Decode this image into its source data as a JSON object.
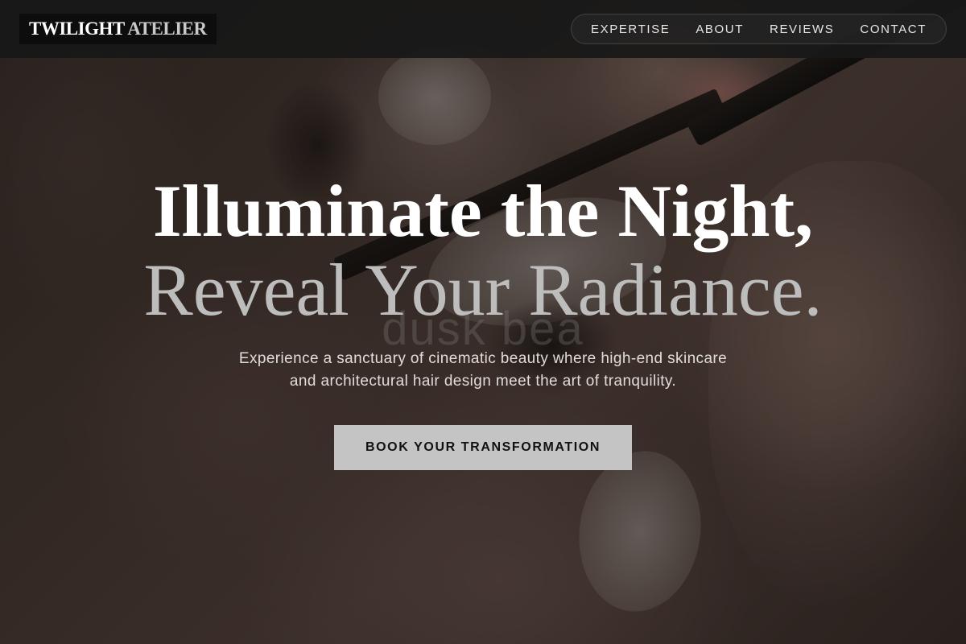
{
  "brand": {
    "word1": "TWILIGHT",
    "word2": "ATELIER"
  },
  "nav": {
    "items": [
      {
        "label": "EXPERTISE"
      },
      {
        "label": "ABOUT"
      },
      {
        "label": "REVIEWS"
      },
      {
        "label": "CONTACT"
      }
    ]
  },
  "hero": {
    "headline_line1": "Illuminate the Night,",
    "headline_line2": "Reveal Your Radiance.",
    "background_watermark": "dusk bea",
    "subtitle": "Experience a sanctuary of cinematic beauty where high-end skincare and architectural hair design meet the art of tranquility.",
    "cta_label": "BOOK YOUR TRANSFORMATION"
  },
  "colors": {
    "nav_background": "#181818",
    "headline": "#ffffff",
    "headline_secondary": "#bdbdbd",
    "cta_background": "#c4c4c4",
    "cta_text": "#111111"
  }
}
